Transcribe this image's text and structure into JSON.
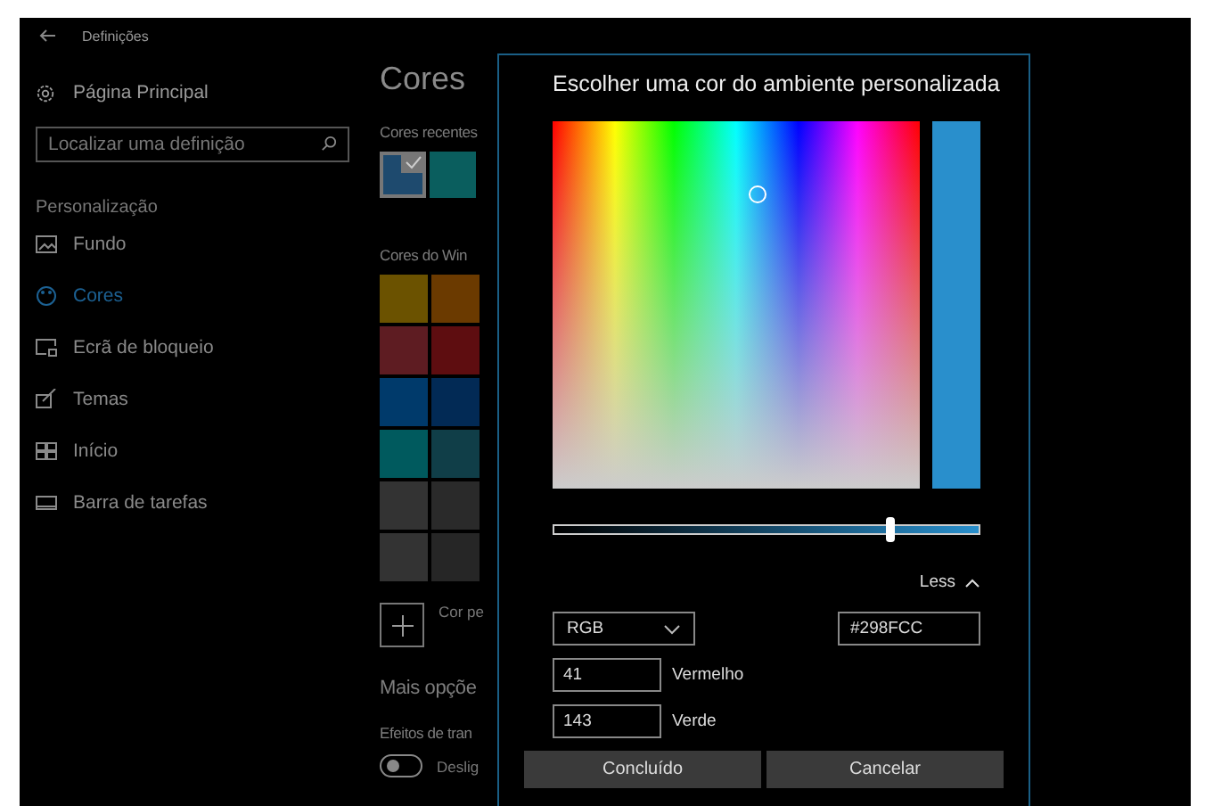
{
  "window": {
    "title": "Definições"
  },
  "sidebar": {
    "home": "Página Principal",
    "search": {
      "placeholder": "Localizar uma definição"
    },
    "section": "Personalização",
    "items": [
      {
        "label": "Fundo",
        "selected": false
      },
      {
        "label": "Cores",
        "selected": true
      },
      {
        "label": "Ecrã de bloqueio",
        "selected": false
      },
      {
        "label": "Temas",
        "selected": false
      },
      {
        "label": "Início",
        "selected": false
      },
      {
        "label": "Barra de tarefas",
        "selected": false
      }
    ]
  },
  "content": {
    "title": "Cores",
    "recent_label": "Cores recentes",
    "recent_colors": [
      {
        "color": "#1e4a6e",
        "selected": true
      },
      {
        "color": "#0a5e5e",
        "selected": false
      }
    ],
    "windows_label": "Cores do Win",
    "windows_colors": [
      {
        "color": "#6b5200"
      },
      {
        "color": "#6b3a00"
      },
      {
        "color": "#5e1c22"
      },
      {
        "color": "#5e0d10"
      },
      {
        "color": "#003a6b"
      },
      {
        "color": "#022a55"
      },
      {
        "color": "#005a5e"
      },
      {
        "color": "#103e48"
      },
      {
        "color": "#333333"
      },
      {
        "color": "#2a2a2a"
      },
      {
        "color": "#333333"
      },
      {
        "color": "#262626"
      }
    ],
    "custom_label": "Cor pe",
    "more_title": "Mais opçõe",
    "effects_label": "Efeitos de tran",
    "toggle": {
      "on": false,
      "label": "Deslig"
    }
  },
  "dialog": {
    "title": "Escolher uma cor do ambiente personalizada",
    "brightness": {
      "level": 0.79
    },
    "less": "Less",
    "mode": "RGB",
    "hex": "#298FCC",
    "channels": [
      {
        "value": "41",
        "label": "Vermelho"
      },
      {
        "value": "143",
        "label": "Verde"
      }
    ],
    "buttons": [
      "Concluído",
      "Cancelar"
    ]
  }
}
